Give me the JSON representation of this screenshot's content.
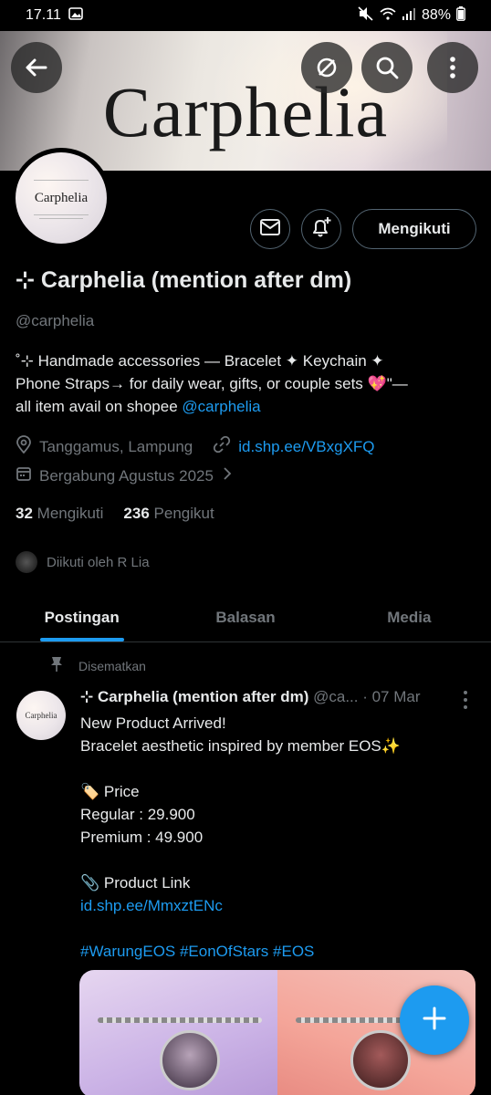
{
  "status_bar": {
    "time": "17.11",
    "battery": "88%"
  },
  "banner": {
    "title": "Carphelia"
  },
  "avatar": {
    "text": "Carphelia"
  },
  "profile": {
    "display_name": "⊹ Carphelia (mention after dm)",
    "handle": "@carphelia",
    "bio_line1": "˚⊹ Handmade accessories — Bracelet ✦ Keychain ✦",
    "bio_line2": "Phone Straps→ for daily wear, gifts, or couple sets 💖\"—",
    "bio_line3_text": "all item avail on shopee ",
    "bio_line3_link": "@carphelia",
    "location": "Tanggamus, Lampung",
    "website": "id.shp.ee/VBxgXFQ",
    "joined": "Bergabung Agustus 2025",
    "following_count": "32",
    "following_label": "Mengikuti",
    "followers_count": "236",
    "followers_label": "Pengikut",
    "followed_by": "Diikuti oleh R Lia"
  },
  "buttons": {
    "follow_label": "Mengikuti"
  },
  "tabs": [
    {
      "label": "Postingan",
      "active": true
    },
    {
      "label": "Balasan",
      "active": false
    },
    {
      "label": "Media",
      "active": false
    }
  ],
  "post": {
    "pinned_label": "Disematkan",
    "avatar_text": "Carphelia",
    "name": "⊹ Carphelia (mention after dm)",
    "handle_date": " @ca... · 07 Mar",
    "line1": "New Product Arrived!",
    "line2": "Bracelet aesthetic inspired by member EOS✨",
    "price_label": "🏷️ Price",
    "regular": "Regular : 29.900",
    "premium": "Premium : 49.900",
    "link_label": "📎 Product Link",
    "link": "id.shp.ee/MmxztENc",
    "hashtags": "#WarungEOS #EonOfStars #EOS"
  },
  "icons": [
    "back-arrow-icon",
    "no-translate-icon",
    "search-icon",
    "more-vertical-icon",
    "mail-icon",
    "bell-plus-icon",
    "location-icon",
    "link-icon",
    "calendar-icon",
    "chevron-right-icon",
    "pin-icon",
    "plus-icon"
  ],
  "colors": {
    "accent": "#1d9bf0",
    "secondary_text": "#71767b",
    "background": "#000000"
  }
}
